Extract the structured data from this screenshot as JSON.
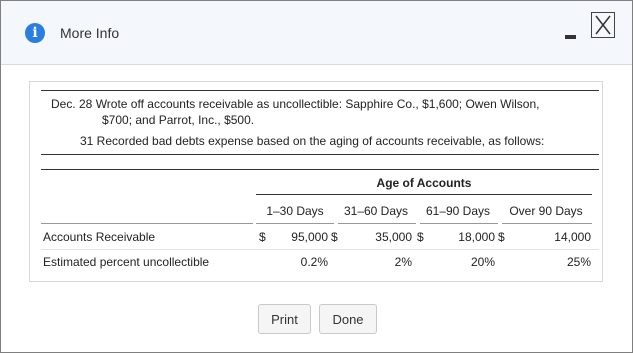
{
  "dialog": {
    "title": "More Info",
    "buttons": {
      "print": "Print",
      "done": "Done"
    }
  },
  "journal": {
    "line1": "Dec. 28 Wrote off accounts receivable as uncollectible: Sapphire Co., $1,600; Owen Wilson,",
    "line2": "$700; and Parrot, Inc., $500.",
    "line3": "31 Recorded bad debts expense based on the aging of accounts receivable, as follows:"
  },
  "table": {
    "group_header": "Age of Accounts",
    "columns": [
      "1–30 Days",
      "31–60 Days",
      "61–90 Days",
      "Over 90 Days"
    ],
    "rows": [
      {
        "label": "Accounts Receivable",
        "cells": [
          {
            "currency": "$",
            "value": "95,000"
          },
          {
            "currency": "$",
            "value": "35,000"
          },
          {
            "currency": "$",
            "value": "18,000"
          },
          {
            "currency": "$",
            "value": "14,000"
          }
        ]
      },
      {
        "label": "Estimated percent uncollectible",
        "cells": [
          {
            "currency": "",
            "value": "0.2%"
          },
          {
            "currency": "",
            "value": "2%"
          },
          {
            "currency": "",
            "value": "20%"
          },
          {
            "currency": "",
            "value": "25%"
          }
        ]
      }
    ]
  }
}
